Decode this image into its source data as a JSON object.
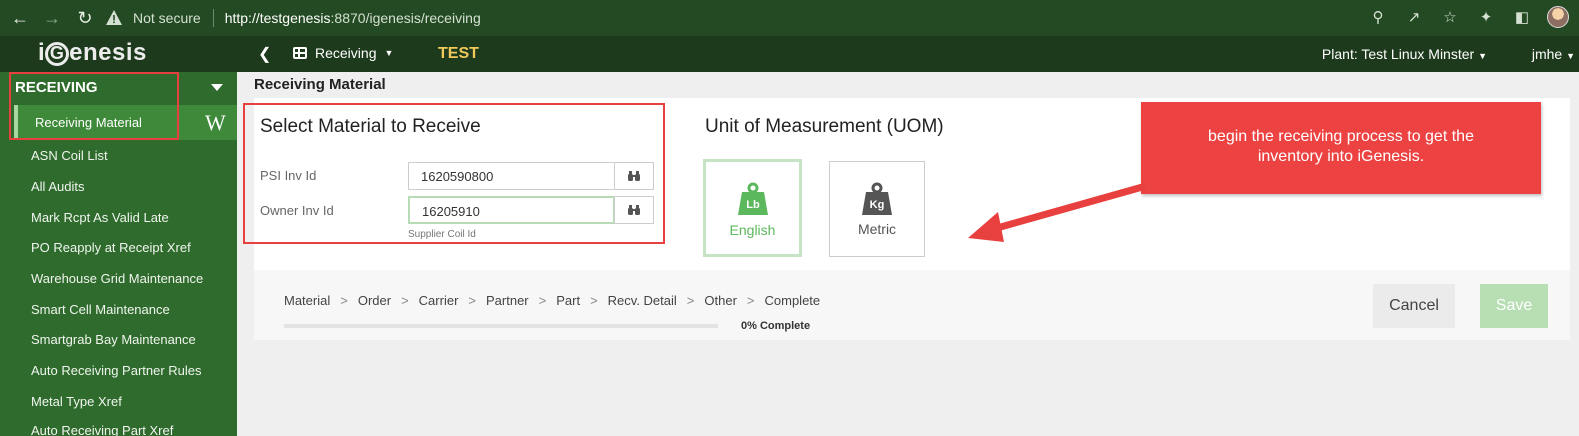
{
  "browser": {
    "security_text": "Not secure",
    "url_host": "http://testgenesis",
    "url_path": ":8870/igenesis/receiving"
  },
  "header": {
    "logo": "iGenesis",
    "module_menu": "Receiving",
    "environment": "TEST",
    "plant": "Plant: Test Linux Minster",
    "user": "jmhe"
  },
  "sidebar": {
    "section": "RECEIVING",
    "active_item": "Receiving Material",
    "items": [
      "ASN Coil List",
      "All Audits",
      "Mark Rcpt As Valid Late",
      "PO Reapply at Receipt Xref",
      "Warehouse Grid Maintenance",
      "Smart Cell Maintenance",
      "Smartgrab Bay Maintenance",
      "Auto Receiving Partner Rules",
      "Metal Type Xref",
      "Auto Receiving Part Xref"
    ]
  },
  "page": {
    "title": "Receiving Material",
    "select_title": "Select Material to Receive",
    "psi_label": "PSI Inv Id",
    "psi_value": "1620590800",
    "owner_label": "Owner Inv Id",
    "owner_value": "16205910",
    "owner_hint": "Supplier Coil Id",
    "uom_title": "Unit of Measurement (UOM)",
    "uom_options": [
      {
        "badge": "Lb",
        "label": "English",
        "selected": true
      },
      {
        "badge": "Kg",
        "label": "Metric",
        "selected": false
      }
    ]
  },
  "callout": {
    "line1": "begin the receiving process to get the",
    "line2": "inventory into iGenesis."
  },
  "wizard": {
    "steps": [
      "Material",
      "Order",
      "Carrier",
      "Partner",
      "Part",
      "Recv. Detail",
      "Other",
      "Complete"
    ],
    "progress_percent": 0,
    "progress_text": "0% Complete",
    "cancel_label": "Cancel",
    "save_label": "Save"
  },
  "colors": {
    "sidebar": "#2f6b2c",
    "header": "#1e3a1c",
    "accent_green": "#4caf50",
    "annotation_red": "#e8403f",
    "env_yellow": "#f0c95a"
  },
  "icons": [
    "back-arrow-icon",
    "forward-arrow-icon",
    "reload-icon",
    "warning-icon",
    "key-icon",
    "share-icon",
    "star-icon",
    "extensions-icon",
    "sidepanel-icon",
    "binoculars-icon",
    "weight-icon"
  ]
}
